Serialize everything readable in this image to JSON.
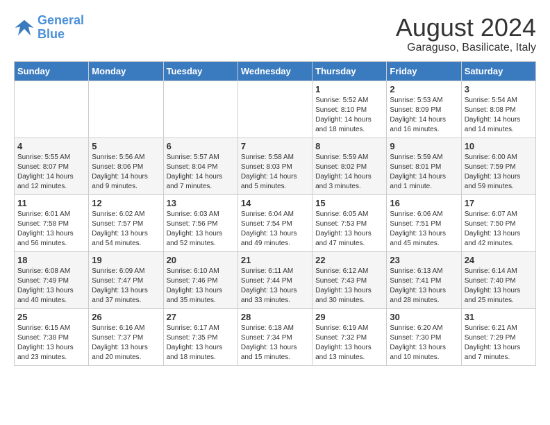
{
  "header": {
    "logo_line1": "General",
    "logo_line2": "Blue",
    "month_year": "August 2024",
    "location": "Garaguso, Basilicate, Italy"
  },
  "weekdays": [
    "Sunday",
    "Monday",
    "Tuesday",
    "Wednesday",
    "Thursday",
    "Friday",
    "Saturday"
  ],
  "weeks": [
    [
      {
        "day": "",
        "info": ""
      },
      {
        "day": "",
        "info": ""
      },
      {
        "day": "",
        "info": ""
      },
      {
        "day": "",
        "info": ""
      },
      {
        "day": "1",
        "info": "Sunrise: 5:52 AM\nSunset: 8:10 PM\nDaylight: 14 hours\nand 18 minutes."
      },
      {
        "day": "2",
        "info": "Sunrise: 5:53 AM\nSunset: 8:09 PM\nDaylight: 14 hours\nand 16 minutes."
      },
      {
        "day": "3",
        "info": "Sunrise: 5:54 AM\nSunset: 8:08 PM\nDaylight: 14 hours\nand 14 minutes."
      }
    ],
    [
      {
        "day": "4",
        "info": "Sunrise: 5:55 AM\nSunset: 8:07 PM\nDaylight: 14 hours\nand 12 minutes."
      },
      {
        "day": "5",
        "info": "Sunrise: 5:56 AM\nSunset: 8:06 PM\nDaylight: 14 hours\nand 9 minutes."
      },
      {
        "day": "6",
        "info": "Sunrise: 5:57 AM\nSunset: 8:04 PM\nDaylight: 14 hours\nand 7 minutes."
      },
      {
        "day": "7",
        "info": "Sunrise: 5:58 AM\nSunset: 8:03 PM\nDaylight: 14 hours\nand 5 minutes."
      },
      {
        "day": "8",
        "info": "Sunrise: 5:59 AM\nSunset: 8:02 PM\nDaylight: 14 hours\nand 3 minutes."
      },
      {
        "day": "9",
        "info": "Sunrise: 5:59 AM\nSunset: 8:01 PM\nDaylight: 14 hours\nand 1 minute."
      },
      {
        "day": "10",
        "info": "Sunrise: 6:00 AM\nSunset: 7:59 PM\nDaylight: 13 hours\nand 59 minutes."
      }
    ],
    [
      {
        "day": "11",
        "info": "Sunrise: 6:01 AM\nSunset: 7:58 PM\nDaylight: 13 hours\nand 56 minutes."
      },
      {
        "day": "12",
        "info": "Sunrise: 6:02 AM\nSunset: 7:57 PM\nDaylight: 13 hours\nand 54 minutes."
      },
      {
        "day": "13",
        "info": "Sunrise: 6:03 AM\nSunset: 7:56 PM\nDaylight: 13 hours\nand 52 minutes."
      },
      {
        "day": "14",
        "info": "Sunrise: 6:04 AM\nSunset: 7:54 PM\nDaylight: 13 hours\nand 49 minutes."
      },
      {
        "day": "15",
        "info": "Sunrise: 6:05 AM\nSunset: 7:53 PM\nDaylight: 13 hours\nand 47 minutes."
      },
      {
        "day": "16",
        "info": "Sunrise: 6:06 AM\nSunset: 7:51 PM\nDaylight: 13 hours\nand 45 minutes."
      },
      {
        "day": "17",
        "info": "Sunrise: 6:07 AM\nSunset: 7:50 PM\nDaylight: 13 hours\nand 42 minutes."
      }
    ],
    [
      {
        "day": "18",
        "info": "Sunrise: 6:08 AM\nSunset: 7:49 PM\nDaylight: 13 hours\nand 40 minutes."
      },
      {
        "day": "19",
        "info": "Sunrise: 6:09 AM\nSunset: 7:47 PM\nDaylight: 13 hours\nand 37 minutes."
      },
      {
        "day": "20",
        "info": "Sunrise: 6:10 AM\nSunset: 7:46 PM\nDaylight: 13 hours\nand 35 minutes."
      },
      {
        "day": "21",
        "info": "Sunrise: 6:11 AM\nSunset: 7:44 PM\nDaylight: 13 hours\nand 33 minutes."
      },
      {
        "day": "22",
        "info": "Sunrise: 6:12 AM\nSunset: 7:43 PM\nDaylight: 13 hours\nand 30 minutes."
      },
      {
        "day": "23",
        "info": "Sunrise: 6:13 AM\nSunset: 7:41 PM\nDaylight: 13 hours\nand 28 minutes."
      },
      {
        "day": "24",
        "info": "Sunrise: 6:14 AM\nSunset: 7:40 PM\nDaylight: 13 hours\nand 25 minutes."
      }
    ],
    [
      {
        "day": "25",
        "info": "Sunrise: 6:15 AM\nSunset: 7:38 PM\nDaylight: 13 hours\nand 23 minutes."
      },
      {
        "day": "26",
        "info": "Sunrise: 6:16 AM\nSunset: 7:37 PM\nDaylight: 13 hours\nand 20 minutes."
      },
      {
        "day": "27",
        "info": "Sunrise: 6:17 AM\nSunset: 7:35 PM\nDaylight: 13 hours\nand 18 minutes."
      },
      {
        "day": "28",
        "info": "Sunrise: 6:18 AM\nSunset: 7:34 PM\nDaylight: 13 hours\nand 15 minutes."
      },
      {
        "day": "29",
        "info": "Sunrise: 6:19 AM\nSunset: 7:32 PM\nDaylight: 13 hours\nand 13 minutes."
      },
      {
        "day": "30",
        "info": "Sunrise: 6:20 AM\nSunset: 7:30 PM\nDaylight: 13 hours\nand 10 minutes."
      },
      {
        "day": "31",
        "info": "Sunrise: 6:21 AM\nSunset: 7:29 PM\nDaylight: 13 hours\nand 7 minutes."
      }
    ]
  ]
}
